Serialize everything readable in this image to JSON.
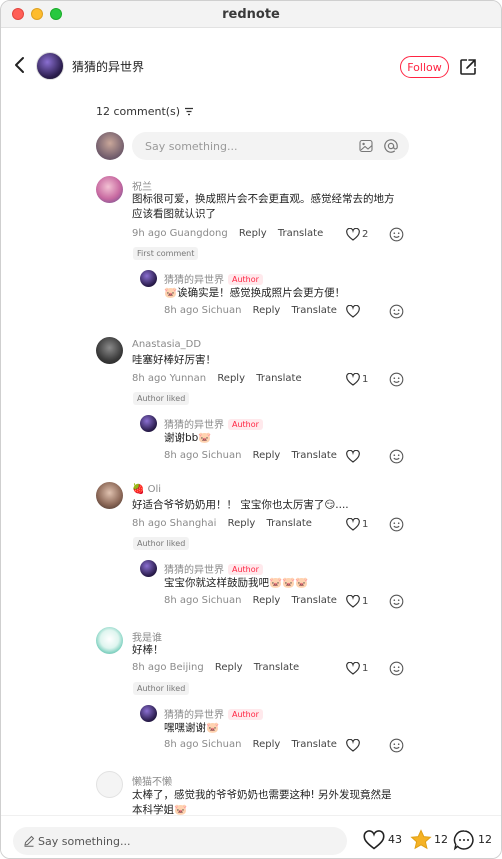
{
  "window": {
    "title": "rednote"
  },
  "header": {
    "author_name": "猜猜的异世界",
    "follow_label": "Follow"
  },
  "comments_header": {
    "count_label": "12 comment(s)"
  },
  "composer": {
    "placeholder": "Say something..."
  },
  "comments": [
    {
      "user": "祝兰",
      "text_line1": "图标很可爱，换成照片会不会更直观。感觉经常去的地方",
      "text_line2": "应该看图就认识了",
      "time": "9h ago",
      "location": "Guangdong",
      "reply": "Reply",
      "translate": "Translate",
      "likes": "2",
      "badge": "First comment",
      "reply_item": {
        "user": "猜猜的异世界",
        "tag": "Author",
        "text": "🐷诶确实是！感觉换成照片会更方便！",
        "time": "8h ago",
        "location": "Sichuan",
        "reply": "Reply",
        "translate": "Translate",
        "likes": ""
      }
    },
    {
      "user": "Anastasia_DD",
      "text_line1": "哇塞好棒好厉害！",
      "time": "8h ago",
      "location": "Yunnan",
      "reply": "Reply",
      "translate": "Translate",
      "likes": "1",
      "badge": "Author liked",
      "reply_item": {
        "user": "猜猜的异世界",
        "tag": "Author",
        "text": "谢谢bb🐷",
        "time": "8h ago",
        "location": "Sichuan",
        "reply": "Reply",
        "translate": "Translate",
        "likes": ""
      }
    },
    {
      "user": "🍓 Oli",
      "text_line1": "好适合爷爷奶奶用！！ 宝宝你也太厉害了😏....",
      "time": "8h ago",
      "location": "Shanghai",
      "reply": "Reply",
      "translate": "Translate",
      "likes": "1",
      "badge": "Author liked",
      "reply_item": {
        "user": "猜猜的异世界",
        "tag": "Author",
        "text": "宝宝你就这样鼓励我吧🐷🐷🐷",
        "time": "8h ago",
        "location": "Sichuan",
        "reply": "Reply",
        "translate": "Translate",
        "likes": "1"
      }
    },
    {
      "user": "我是谁",
      "text_line1": "好棒！",
      "time": "8h ago",
      "location": "Beijing",
      "reply": "Reply",
      "translate": "Translate",
      "likes": "1",
      "badge": "Author liked",
      "reply_item": {
        "user": "猜猜的异世界",
        "tag": "Author",
        "text": "嘿嘿谢谢🐷",
        "time": "8h ago",
        "location": "Sichuan",
        "reply": "Reply",
        "translate": "Translate",
        "likes": ""
      }
    },
    {
      "user": "懒猫不懒",
      "text_line1": "太棒了，感觉我的爷爷奶奶也需要这种! 另外发现竟然是",
      "text_line2": "本科学姐🐷"
    }
  ],
  "bottom_bar": {
    "placeholder": "Say something...",
    "likes": "43",
    "stars": "12",
    "comments": "12"
  },
  "colors": {
    "accent": "#ff2442",
    "star": "#f5b225"
  }
}
